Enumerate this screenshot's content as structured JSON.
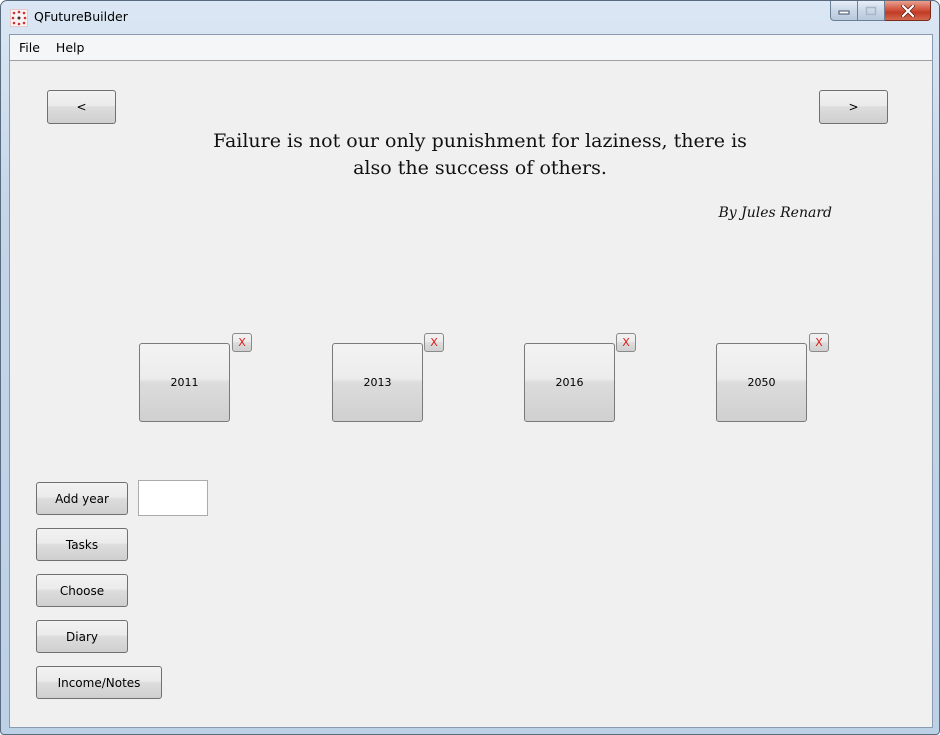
{
  "window": {
    "title": "QFutureBuilder",
    "app_icon": "qfuturebuilder-logo-icon",
    "caption_buttons": [
      "minimize-icon",
      "maximize-icon",
      "close-icon"
    ]
  },
  "menubar": {
    "items": [
      {
        "label": "File"
      },
      {
        "label": "Help"
      }
    ]
  },
  "quote_panel": {
    "prev_label": "<",
    "next_label": ">",
    "quote_text": "Failure is not our only punishment for laziness, there is also the success of others.",
    "author": "By Jules Renard"
  },
  "years": [
    {
      "label": "2011",
      "remove_label": "X"
    },
    {
      "label": "2013",
      "remove_label": "X"
    },
    {
      "label": "2016",
      "remove_label": "X"
    },
    {
      "label": "2050",
      "remove_label": "X"
    }
  ],
  "actions": {
    "add_year_label": "Add year",
    "year_input_value": "",
    "tasks_label": "Tasks",
    "choose_label": "Choose",
    "diary_label": "Diary",
    "income_notes_label": "Income/Notes"
  },
  "colors": {
    "remove_x": "#e01818",
    "close_button": "#c8432c",
    "window_background": "#f0f0f0"
  }
}
